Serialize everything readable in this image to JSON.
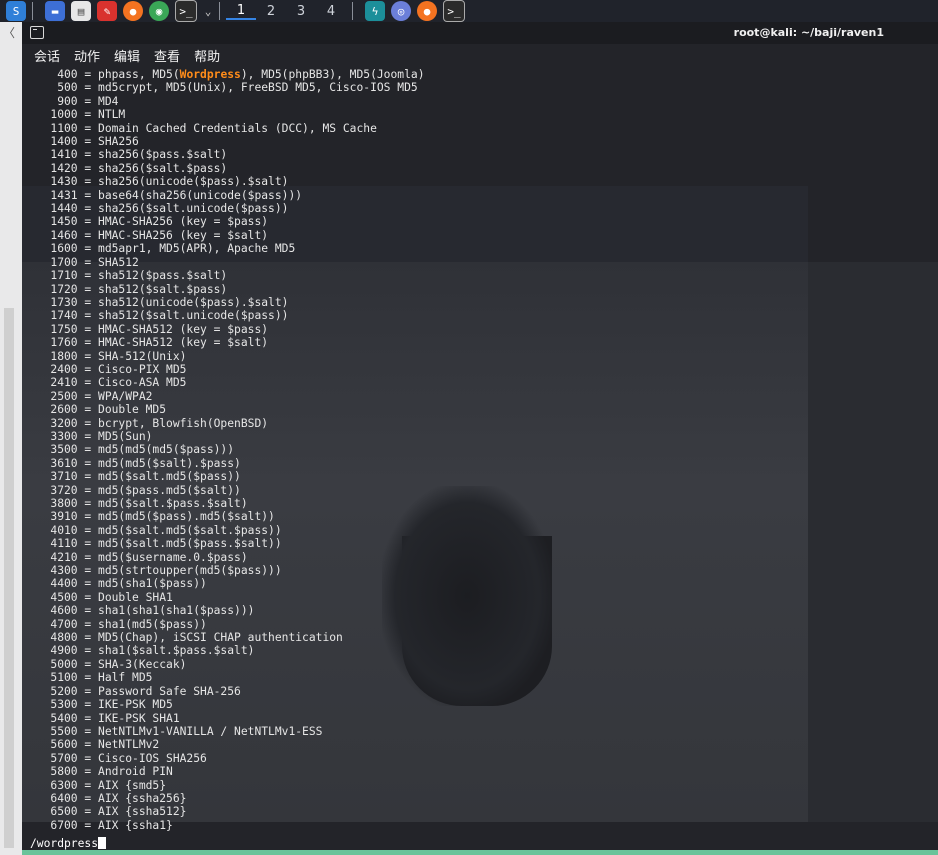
{
  "taskbar": {
    "workspaces": [
      "1",
      "2",
      "3",
      "4"
    ],
    "active_workspace": "1",
    "app_icons": [
      "kali-menu-icon",
      "show-desktop-icon",
      "file-manager-icon",
      "text-editor-icon",
      "firefox-icon",
      "chrome-icon",
      "terminal-icon"
    ],
    "right_icons": [
      "burp-icon",
      "tor-icon",
      "firefox-icon",
      "terminal-icon"
    ]
  },
  "terminal": {
    "title": "root@kali: ~/baji/raven1",
    "menu": [
      "会话",
      "动作",
      "编辑",
      "查看",
      "帮助"
    ],
    "lines": [
      {
        "text": "    400 = phpass, MD5(",
        "hl": "Wordpress",
        "rest": "), MD5(phpBB3), MD5(Joomla)"
      },
      {
        "text": "    500 = md5crypt, MD5(Unix), FreeBSD MD5, Cisco-IOS MD5"
      },
      {
        "text": "    900 = MD4"
      },
      {
        "text": "   1000 = NTLM"
      },
      {
        "text": "   1100 = Domain Cached Credentials (DCC), MS Cache"
      },
      {
        "text": "   1400 = SHA256"
      },
      {
        "text": "   1410 = sha256($pass.$salt)"
      },
      {
        "text": "   1420 = sha256($salt.$pass)"
      },
      {
        "text": "   1430 = sha256(unicode($pass).$salt)"
      },
      {
        "text": "   1431 = base64(sha256(unicode($pass)))"
      },
      {
        "text": "   1440 = sha256($salt.unicode($pass))"
      },
      {
        "text": "   1450 = HMAC-SHA256 (key = $pass)"
      },
      {
        "text": "   1460 = HMAC-SHA256 (key = $salt)"
      },
      {
        "text": "   1600 = md5apr1, MD5(APR), Apache MD5"
      },
      {
        "text": "   1700 = SHA512"
      },
      {
        "text": "   1710 = sha512($pass.$salt)"
      },
      {
        "text": "   1720 = sha512($salt.$pass)"
      },
      {
        "text": "   1730 = sha512(unicode($pass).$salt)"
      },
      {
        "text": "   1740 = sha512($salt.unicode($pass))"
      },
      {
        "text": "   1750 = HMAC-SHA512 (key = $pass)"
      },
      {
        "text": "   1760 = HMAC-SHA512 (key = $salt)"
      },
      {
        "text": "   1800 = SHA-512(Unix)"
      },
      {
        "text": "   2400 = Cisco-PIX MD5"
      },
      {
        "text": "   2410 = Cisco-ASA MD5"
      },
      {
        "text": "   2500 = WPA/WPA2"
      },
      {
        "text": "   2600 = Double MD5"
      },
      {
        "text": "   3200 = bcrypt, Blowfish(OpenBSD)"
      },
      {
        "text": "   3300 = MD5(Sun)"
      },
      {
        "text": "   3500 = md5(md5(md5($pass)))"
      },
      {
        "text": "   3610 = md5(md5($salt).$pass)"
      },
      {
        "text": "   3710 = md5($salt.md5($pass))"
      },
      {
        "text": "   3720 = md5($pass.md5($salt))"
      },
      {
        "text": "   3800 = md5($salt.$pass.$salt)"
      },
      {
        "text": "   3910 = md5(md5($pass).md5($salt))"
      },
      {
        "text": "   4010 = md5($salt.md5($salt.$pass))"
      },
      {
        "text": "   4110 = md5($salt.md5($pass.$salt))"
      },
      {
        "text": "   4210 = md5($username.0.$pass)"
      },
      {
        "text": "   4300 = md5(strtoupper(md5($pass)))"
      },
      {
        "text": "   4400 = md5(sha1($pass))"
      },
      {
        "text": "   4500 = Double SHA1"
      },
      {
        "text": "   4600 = sha1(sha1(sha1($pass)))"
      },
      {
        "text": "   4700 = sha1(md5($pass))"
      },
      {
        "text": "   4800 = MD5(Chap), iSCSI CHAP authentication"
      },
      {
        "text": "   4900 = sha1($salt.$pass.$salt)"
      },
      {
        "text": "   5000 = SHA-3(Keccak)"
      },
      {
        "text": "   5100 = Half MD5"
      },
      {
        "text": "   5200 = Password Safe SHA-256"
      },
      {
        "text": "   5300 = IKE-PSK MD5"
      },
      {
        "text": "   5400 = IKE-PSK SHA1"
      },
      {
        "text": "   5500 = NetNTLMv1-VANILLA / NetNTLMv1-ESS"
      },
      {
        "text": "   5600 = NetNTLMv2"
      },
      {
        "text": "   5700 = Cisco-IOS SHA256"
      },
      {
        "text": "   5800 = Android PIN"
      },
      {
        "text": "   6300 = AIX {smd5}"
      },
      {
        "text": "   6400 = AIX {ssha256}"
      },
      {
        "text": "   6500 = AIX {ssha512}"
      },
      {
        "text": "   6700 = AIX {ssha1}"
      }
    ],
    "prompt": "/wordpress",
    "colors": {
      "background": "#232429",
      "text": "#e6e6e6",
      "highlight": "#ff8c1a",
      "status_bar": "#6ac39a"
    }
  }
}
